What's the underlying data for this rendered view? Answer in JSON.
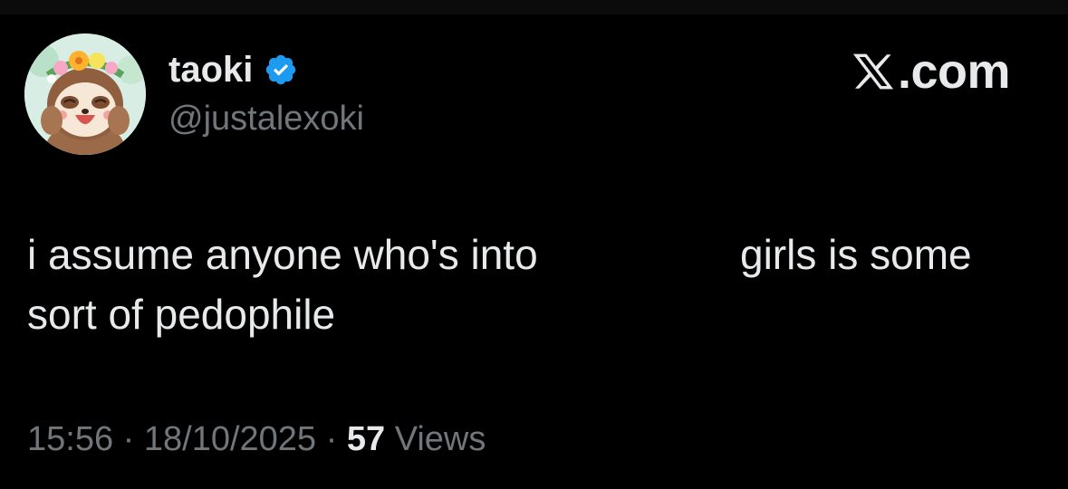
{
  "author": {
    "display_name": "taoki",
    "handle": "@justalexoki",
    "verified": true,
    "avatar_icon": "sloth-with-flower-crown-avatar"
  },
  "brand": {
    "text": "X.com",
    "icon": "x-logo-icon"
  },
  "tweet": {
    "text_line1_part1": "i assume anyone who's into",
    "text_line1_part2": "girls is some",
    "text_line2": "sort of pedophile"
  },
  "meta": {
    "time": "15:56",
    "separator": "·",
    "date": "18/10/2025",
    "views_count": "57",
    "views_label": "Views"
  },
  "colors": {
    "background": "#000000",
    "primary_text": "#e7e9ea",
    "secondary_text": "#71767b",
    "verified_blue": "#1d9bf0"
  }
}
